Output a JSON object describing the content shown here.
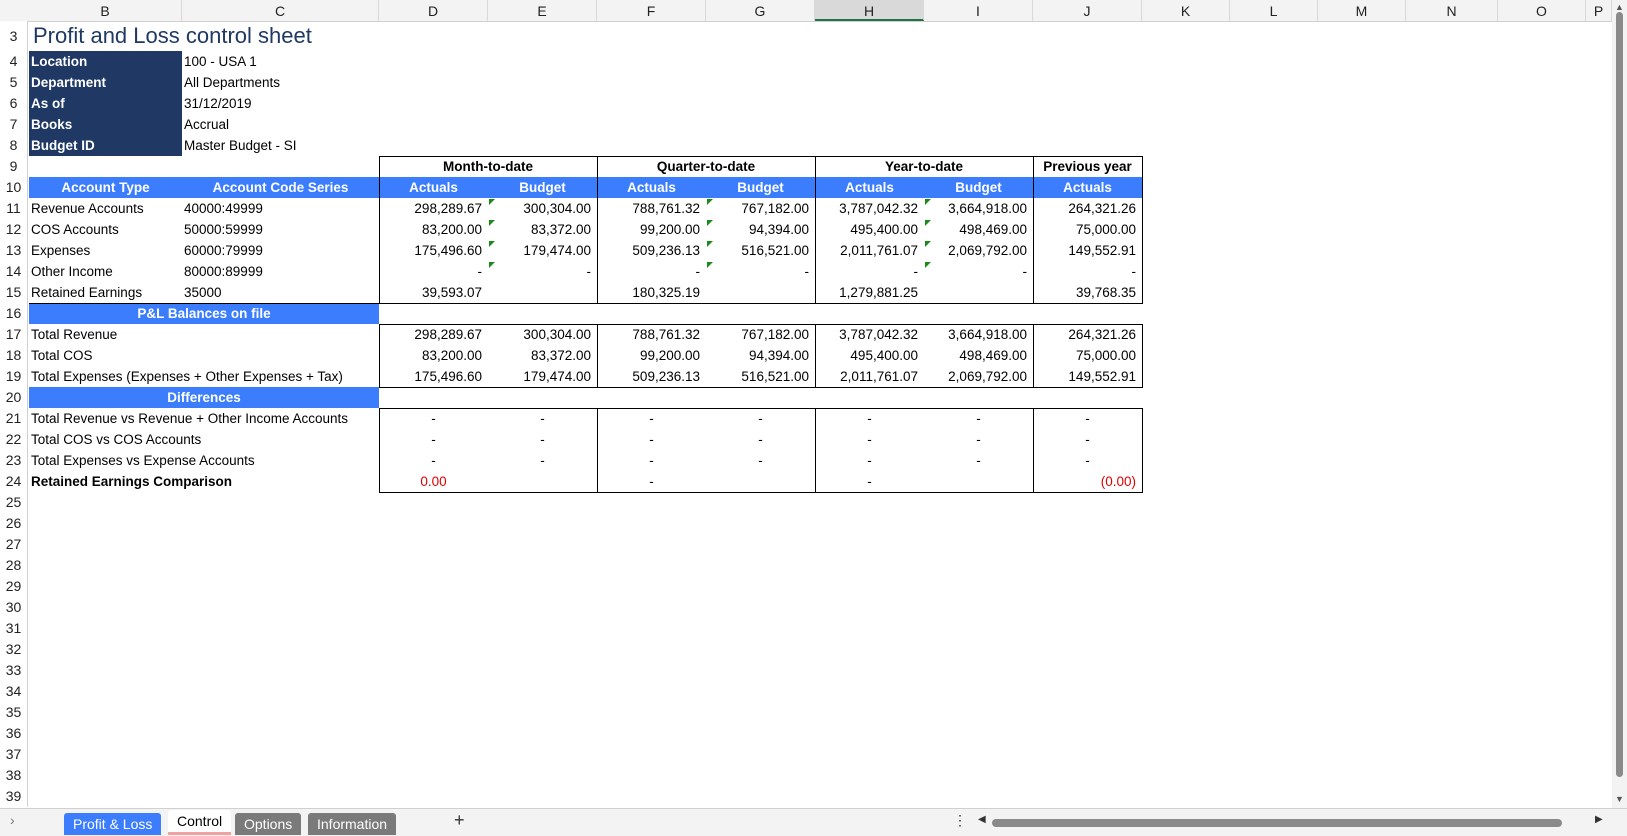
{
  "columns": [
    "B",
    "C",
    "D",
    "E",
    "F",
    "G",
    "H",
    "I",
    "J",
    "K",
    "L",
    "M",
    "N",
    "O",
    "P"
  ],
  "selected_column": "H",
  "rows": [
    "3",
    "4",
    "5",
    "6",
    "7",
    "8",
    "9",
    "10",
    "11",
    "12",
    "13",
    "14",
    "15",
    "16",
    "17",
    "18",
    "19",
    "20",
    "21",
    "22",
    "23",
    "24",
    "25",
    "26",
    "27",
    "28",
    "29",
    "30",
    "31",
    "32",
    "33",
    "34",
    "35",
    "36",
    "37",
    "38",
    "39"
  ],
  "title": "Profit and Loss control sheet",
  "info": [
    {
      "label": "Location",
      "value": "100 - USA 1"
    },
    {
      "label": "Department",
      "value": "All Departments"
    },
    {
      "label": "As of",
      "value": "31/12/2019"
    },
    {
      "label": "Books",
      "value": "Accrual"
    },
    {
      "label": "Budget ID",
      "value": "Master Budget - SI"
    }
  ],
  "periods": [
    "Month-to-date",
    "Quarter-to-date",
    "Year-to-date",
    "Previous year"
  ],
  "headers": [
    "Account Type",
    "Account Code Series",
    "Actuals",
    "Budget",
    "Actuals",
    "Budget",
    "Actuals",
    "Budget",
    "Actuals"
  ],
  "accounts": [
    {
      "type": "Revenue Accounts",
      "code": "40000:49999",
      "vals": [
        "298,289.67",
        "300,304.00",
        "788,761.32",
        "767,182.00",
        "3,787,042.32",
        "3,664,918.00",
        "264,321.26"
      ]
    },
    {
      "type": "COS Accounts",
      "code": "50000:59999",
      "vals": [
        "83,200.00",
        "83,372.00",
        "99,200.00",
        "94,394.00",
        "495,400.00",
        "498,469.00",
        "75,000.00"
      ]
    },
    {
      "type": "Expenses",
      "code": "60000:79999",
      "vals": [
        "175,496.60",
        "179,474.00",
        "509,236.13",
        "516,521.00",
        "2,011,761.07",
        "2,069,792.00",
        "149,552.91"
      ]
    },
    {
      "type": "Other Income",
      "code": "80000:89999",
      "vals": [
        "-",
        "-",
        "-",
        "-",
        "-",
        "-",
        "-"
      ]
    },
    {
      "type": "Retained Earnings",
      "code": "35000",
      "vals": [
        "39,593.07",
        "",
        "180,325.19",
        "",
        "1,279,881.25",
        "",
        "39,768.35"
      ]
    }
  ],
  "section_balances": "P&L Balances on file",
  "balances": [
    {
      "label": "Total Revenue",
      "vals": [
        "298,289.67",
        "300,304.00",
        "788,761.32",
        "767,182.00",
        "3,787,042.32",
        "3,664,918.00",
        "264,321.26"
      ]
    },
    {
      "label": "Total COS",
      "vals": [
        "83,200.00",
        "83,372.00",
        "99,200.00",
        "94,394.00",
        "495,400.00",
        "498,469.00",
        "75,000.00"
      ]
    },
    {
      "label": "Total Expenses (Expenses + Other Expenses + Tax)",
      "vals": [
        "175,496.60",
        "179,474.00",
        "509,236.13",
        "516,521.00",
        "2,011,761.07",
        "2,069,792.00",
        "149,552.91"
      ]
    }
  ],
  "section_differences": "Differences",
  "differences": [
    {
      "label": "Total Revenue vs Revenue + Other Income Accounts",
      "vals": [
        "-",
        "-",
        "-",
        "-",
        "-",
        "-",
        "-"
      ]
    },
    {
      "label": "Total COS vs COS Accounts",
      "vals": [
        "-",
        "-",
        "-",
        "-",
        "-",
        "-",
        "-"
      ]
    },
    {
      "label": "Total Expenses vs Expense Accounts",
      "vals": [
        "-",
        "-",
        "-",
        "-",
        "-",
        "-",
        "-"
      ]
    }
  ],
  "retained": {
    "label": "Retained Earnings Comparison",
    "mtd": "0.00",
    "qtd": "-",
    "ytd": "-",
    "py": "(0.00)"
  },
  "tabs": [
    {
      "label": "Profit & Loss",
      "state": "blue"
    },
    {
      "label": "Control",
      "state": "active"
    },
    {
      "label": "Options",
      "state": "gray"
    },
    {
      "label": "Information",
      "state": "gray"
    }
  ],
  "add_sheet": "+",
  "colors": {
    "navy": "#1f3864",
    "blue": "#3c7dfe",
    "red": "#e00000",
    "green_triangle": "#1a8a1a"
  }
}
